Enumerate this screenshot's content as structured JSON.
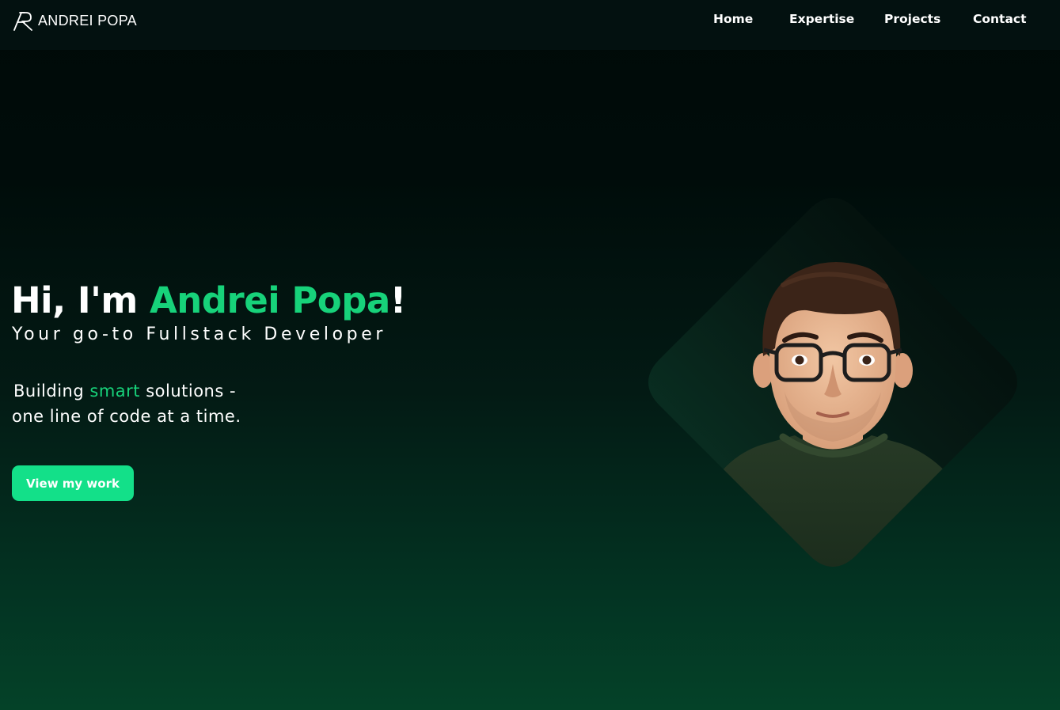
{
  "brand": {
    "name": "ANDREI POPA",
    "logo_icon": "ap-monogram-icon"
  },
  "nav": {
    "links": [
      {
        "label": "Home"
      },
      {
        "label": "Expertise"
      },
      {
        "label": "Projects"
      },
      {
        "label": "Contact"
      }
    ]
  },
  "hero": {
    "greeting": "Hi, I'm ",
    "name": "Andrei Popa",
    "exclaim": "!",
    "subtitle": "Your go-to Fullstack Developer",
    "tagline_before": "Building ",
    "tagline_accent": "smart",
    "tagline_after": " solutions -",
    "tagline_line2": "one line of code at a time.",
    "cta_label": "View my work",
    "portrait_icon": "developer-avatar-icon"
  },
  "colors": {
    "accent": "#17d27a",
    "button": "#13e089",
    "navbar": "#031110",
    "background_top": "#000a08",
    "background_bottom": "#044228"
  }
}
